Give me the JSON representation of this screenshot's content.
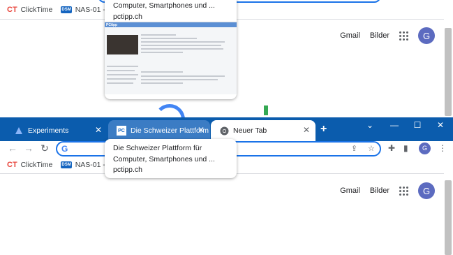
{
  "bookmarks": [
    {
      "label": "ClickTime",
      "icon": "clicktime-icon"
    },
    {
      "label": "NAS-01 - Syno",
      "icon": "dsm-icon"
    }
  ],
  "google_links": {
    "gmail": "Gmail",
    "images": "Bilder",
    "avatar": "G"
  },
  "hover_card": {
    "title_line1": "Die Schweizer Plattform für",
    "title_line2": "Computer, Smartphones und ...",
    "domain": "pctipp.ch"
  },
  "bg_hover_card": {
    "title_line2": "Computer, Smartphones und ...",
    "domain": "pctipp.ch"
  },
  "tabs": [
    {
      "label": "Experiments",
      "icon": "experiments-icon"
    },
    {
      "label": "Die Schweizer Plattform f",
      "icon": "pctipp-icon",
      "icon_text": "PC"
    },
    {
      "label": "Neuer Tab",
      "icon": "chrome-icon"
    }
  ],
  "window_controls": {
    "collapse": "⌄",
    "minimize": "—",
    "maximize": "☐",
    "close": "✕"
  },
  "omnibox": {
    "value": "",
    "placeholder": ""
  },
  "profile_initial": "G",
  "colors": {
    "tabstrip": "#0b5cad",
    "accent": "#1a73e8",
    "avatar": "#5c6bc0"
  }
}
